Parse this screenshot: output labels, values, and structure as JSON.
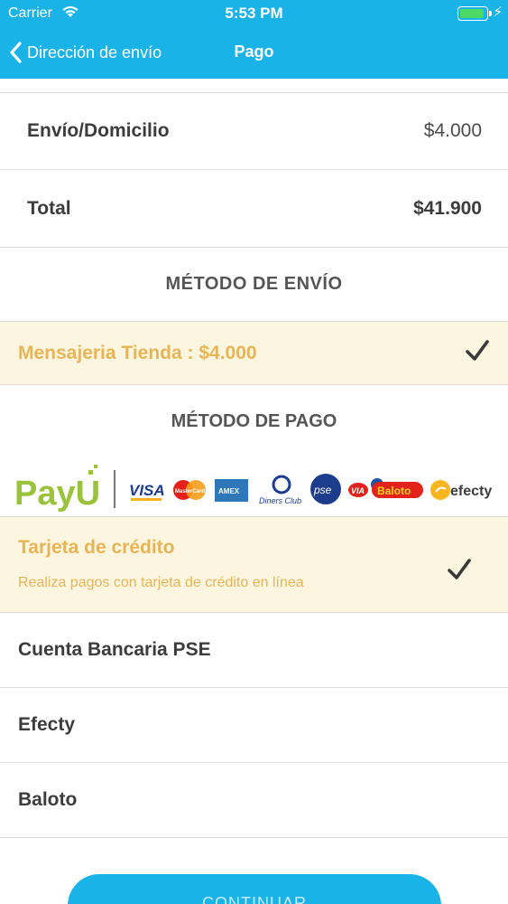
{
  "status_bar": {
    "carrier": "Carrier",
    "time": "5:53 PM",
    "battery_level": 0.9,
    "battery_color": "#4cd964"
  },
  "nav": {
    "back_label": "Dirección de envío",
    "title": "Pago",
    "back_icon": "chevron-left-icon"
  },
  "summary": {
    "shipping_label": "Envío/Domicilio",
    "shipping_value": "$4.000",
    "total_label": "Total",
    "total_value": "$41.900"
  },
  "shipping_method": {
    "title": "MÉTODO DE ENVÍO",
    "selected_option": "Mensajeria Tienda : $4.000",
    "selected_icon": "checkmark-icon"
  },
  "payment_method": {
    "title": "MÉTODO DE PAGO",
    "logos": {
      "payu": "PayU",
      "visa": "VISA",
      "mastercard": "MasterCard",
      "amex": "AMEX",
      "diners": "Diners Club",
      "pse": "pse",
      "via": "VIA",
      "baloto": "Baloto",
      "efecty": "efecty"
    },
    "options": [
      {
        "label": "Tarjeta de crédito",
        "description": "Realiza pagos con tarjeta de crédito en línea",
        "selected": true
      },
      {
        "label": "Cuenta Bancaria PSE"
      },
      {
        "label": "Efecty"
      },
      {
        "label": "Baloto"
      }
    ]
  },
  "continue_label": "CONTINUAR",
  "colors": {
    "primary": "#1ab3e8",
    "selected_bg": "#fcf6e0",
    "selected_text": "#e8b455"
  }
}
